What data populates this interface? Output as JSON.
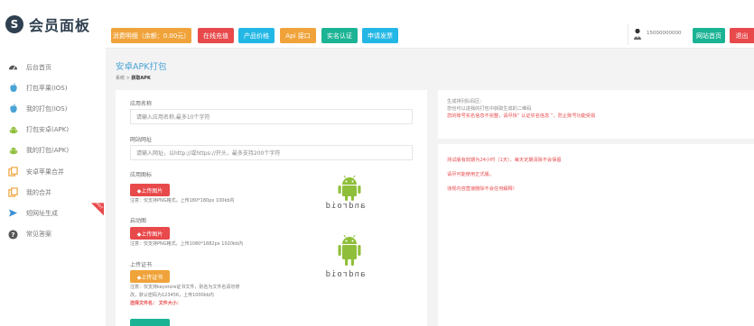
{
  "brand": {
    "logo_mark": "S",
    "title": "会员面板"
  },
  "sidebar": {
    "items": [
      {
        "label": "后台首页",
        "icon": "dashboard-icon",
        "color": "#555555"
      },
      {
        "label": "打包苹果(IOS)",
        "icon": "apple-icon",
        "color": "#4aa3d5"
      },
      {
        "label": "我的打包(IOS)",
        "icon": "apple-icon",
        "color": "#4aa3d5"
      },
      {
        "label": "打包安卓(APK)",
        "icon": "android-icon",
        "color": "#8fbf3a"
      },
      {
        "label": "我的打包(APK)",
        "icon": "android-icon",
        "color": "#8fbf3a"
      },
      {
        "label": "安卓苹果合并",
        "icon": "copy-icon",
        "color": "#f0a33a"
      },
      {
        "label": "我的合并",
        "icon": "copy-icon",
        "color": "#f0a33a"
      },
      {
        "label": "短网址生成",
        "icon": "plane-icon",
        "color": "#3a8fd5",
        "badge": "HOT"
      },
      {
        "label": "常见答案",
        "icon": "question-icon",
        "color": "#555555"
      }
    ]
  },
  "topbar": {
    "buttons": [
      {
        "label": "消费明细（余额：0.00元）",
        "color": "#f0a33a"
      },
      {
        "label": "在线充值",
        "color": "#e8494b"
      },
      {
        "label": "产品价格",
        "color": "#23b7e5"
      },
      {
        "label": "Api 接口",
        "color": "#f0a33a"
      },
      {
        "label": "实名认证",
        "color": "#1ab394"
      },
      {
        "label": "申请发票",
        "color": "#23b7e5"
      }
    ],
    "phone": "15000000000",
    "home_label": "网站首页",
    "logout_label": "退出"
  },
  "page": {
    "title": "安卓APK打包",
    "breadcrumb_home": "系统",
    "breadcrumb_sep": ">",
    "breadcrumb_current": "获取APK"
  },
  "form": {
    "app_name_label": "应用名称",
    "app_name_placeholder": "请输入应用名称,最多10个字符",
    "url_label": "网站网址",
    "url_placeholder": "请输入网址，以http://或https://开头，最多支持200个字符",
    "icon_label": "应用图标",
    "icon_button": "◆上传图片",
    "icon_note": "注意：仅支持PNG格式，上传180*180px 100kb内",
    "splash_label": "启动图",
    "splash_button": "◆上传图片",
    "splash_note": "注意：仅支持PNG格式，上传1080*1882px 1020kb内",
    "cert_label": "上传证书",
    "cert_button": "◆上传证书",
    "cert_note_1": "注意：仅支持keystore证书文件，别名为文件名请勿修",
    "cert_note_2": "改，默认密码为123456，上传1000kb内",
    "cert_selected": "选择文件名：  文件大小：",
    "android_word": "android"
  },
  "right": {
    "box1": {
      "line1": "生成排列队码区：",
      "line2": "您也可以进我的打包中获取生成的二维码",
      "line3": "您的账号实名信息不完整，请尽快“ 认证实名信息 ”，防止账号功能受损"
    },
    "box2": {
      "line1": "测试版有效期为24小时（1天），每天定期清除不会保留",
      "line2": "请尽可能使用正式版。",
      "line3": "违规内容直接删除不会任何解释！"
    }
  }
}
